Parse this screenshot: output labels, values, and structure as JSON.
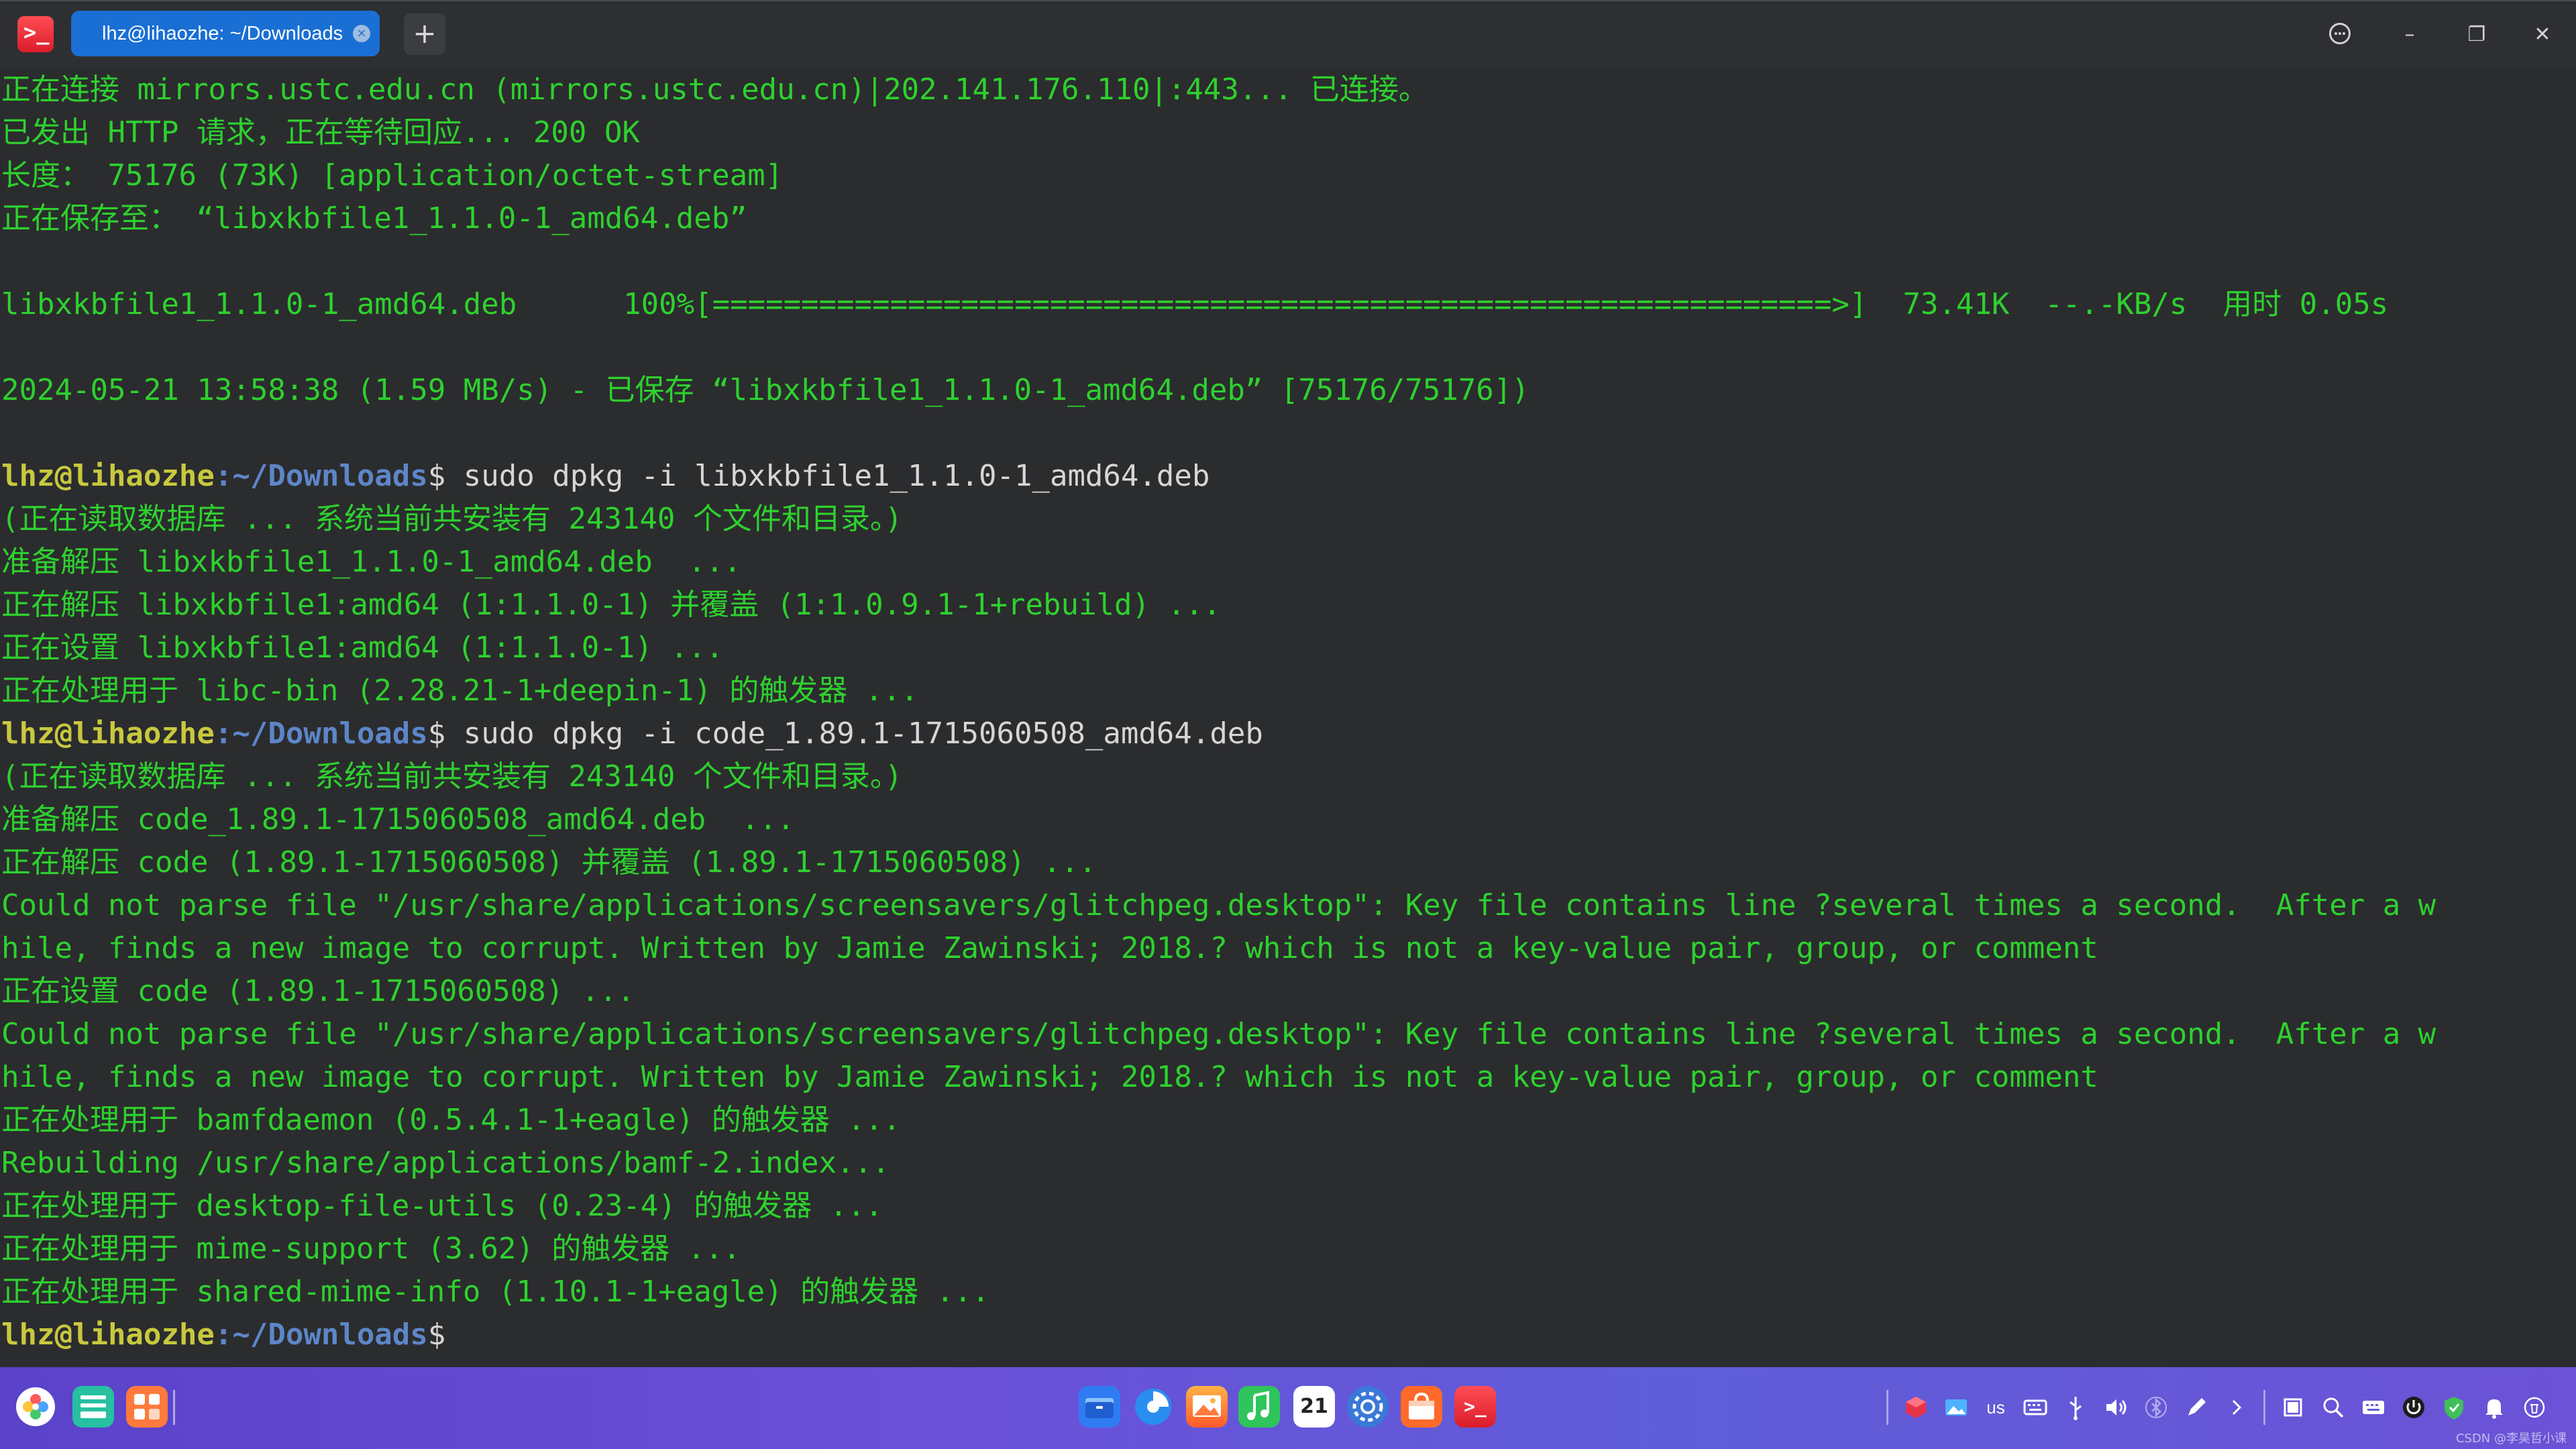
{
  "window": {
    "tab_title": "lhz@lihaozhe: ~/Downloads",
    "new_tab_symbol": "+",
    "close_tab_symbol": "×",
    "minimize_symbol": "–",
    "restore_symbol": "❐",
    "close_symbol": "✕",
    "app_icon_glyph": ">_"
  },
  "prompt": {
    "user_host": "lhz@lihaozhe",
    "path": ":~/Downloads",
    "symbol": "$"
  },
  "terminal": {
    "lines": [
      "正在连接 mirrors.ustc.edu.cn (mirrors.ustc.edu.cn)|202.141.176.110|:443... 已连接。",
      "已发出 HTTP 请求，正在等待回应... 200 OK",
      "长度： 75176 (73K) [application/octet-stream]",
      "正在保存至： “libxkbfile1_1.1.0-1_amd64.deb”",
      "",
      "libxkbfile1_1.1.0-1_amd64.deb      100%[===============================================================>]  73.41K  --.-KB/s  用时 0.05s",
      "",
      "2024-05-21 13:58:38 (1.59 MB/s) - 已保存 “libxkbfile1_1.1.0-1_amd64.deb” [75176/75176])",
      "",
      null,
      "(正在读取数据库 ... 系统当前共安装有 243140 个文件和目录。)",
      "准备解压 libxkbfile1_1.1.0-1_amd64.deb  ...",
      "正在解压 libxkbfile1:amd64 (1:1.1.0-1) 并覆盖 (1:1.0.9.1-1+rebuild) ...",
      "正在设置 libxkbfile1:amd64 (1:1.1.0-1) ...",
      "正在处理用于 libc-bin (2.28.21-1+deepin-1) 的触发器 ...",
      null,
      "(正在读取数据库 ... 系统当前共安装有 243140 个文件和目录。)",
      "准备解压 code_1.89.1-1715060508_amd64.deb  ...",
      "正在解压 code (1.89.1-1715060508) 并覆盖 (1.89.1-1715060508) ...",
      "Could not parse file \"/usr/share/applications/screensavers/glitchpeg.desktop\": Key file contains line ?several times a second.  After a w",
      "hile, finds a new image to corrupt. Written by Jamie Zawinski; 2018.? which is not a key-value pair, group, or comment",
      "正在设置 code (1.89.1-1715060508) ...",
      "Could not parse file \"/usr/share/applications/screensavers/glitchpeg.desktop\": Key file contains line ?several times a second.  After a w",
      "hile, finds a new image to corrupt. Written by Jamie Zawinski; 2018.? which is not a key-value pair, group, or comment",
      "正在处理用于 bamfdaemon (0.5.4.1-1+eagle) 的触发器 ...",
      "Rebuilding /usr/share/applications/bamf-2.index...",
      "正在处理用于 desktop-file-utils (0.23-4) 的触发器 ...",
      "正在处理用于 mime-support (3.62) 的触发器 ...",
      "正在处理用于 shared-mime-info (1.10.1-1+eagle) 的触发器 ...",
      null
    ],
    "commands": {
      "9": " sudo dpkg -i libxkbfile1_1.1.0-1_amd64.deb",
      "15": " sudo dpkg -i code_1.89.1-1715060508_amd64.deb",
      "29": ""
    }
  },
  "dock": {
    "calendar_day": "21",
    "keyboard_layout": "us",
    "watermark": "CSDN @李昊哲小课"
  },
  "colors": {
    "terminal_background": "#2b2c2e",
    "output_text": "#2ed12e",
    "prompt_user": "#c8c83e",
    "prompt_path": "#5d86c8",
    "command_text": "#d6d6d6",
    "tab_active": "#1a6fd4",
    "dock_gradient_start": "#5a42c9",
    "dock_gradient_end": "#6b52d6"
  }
}
